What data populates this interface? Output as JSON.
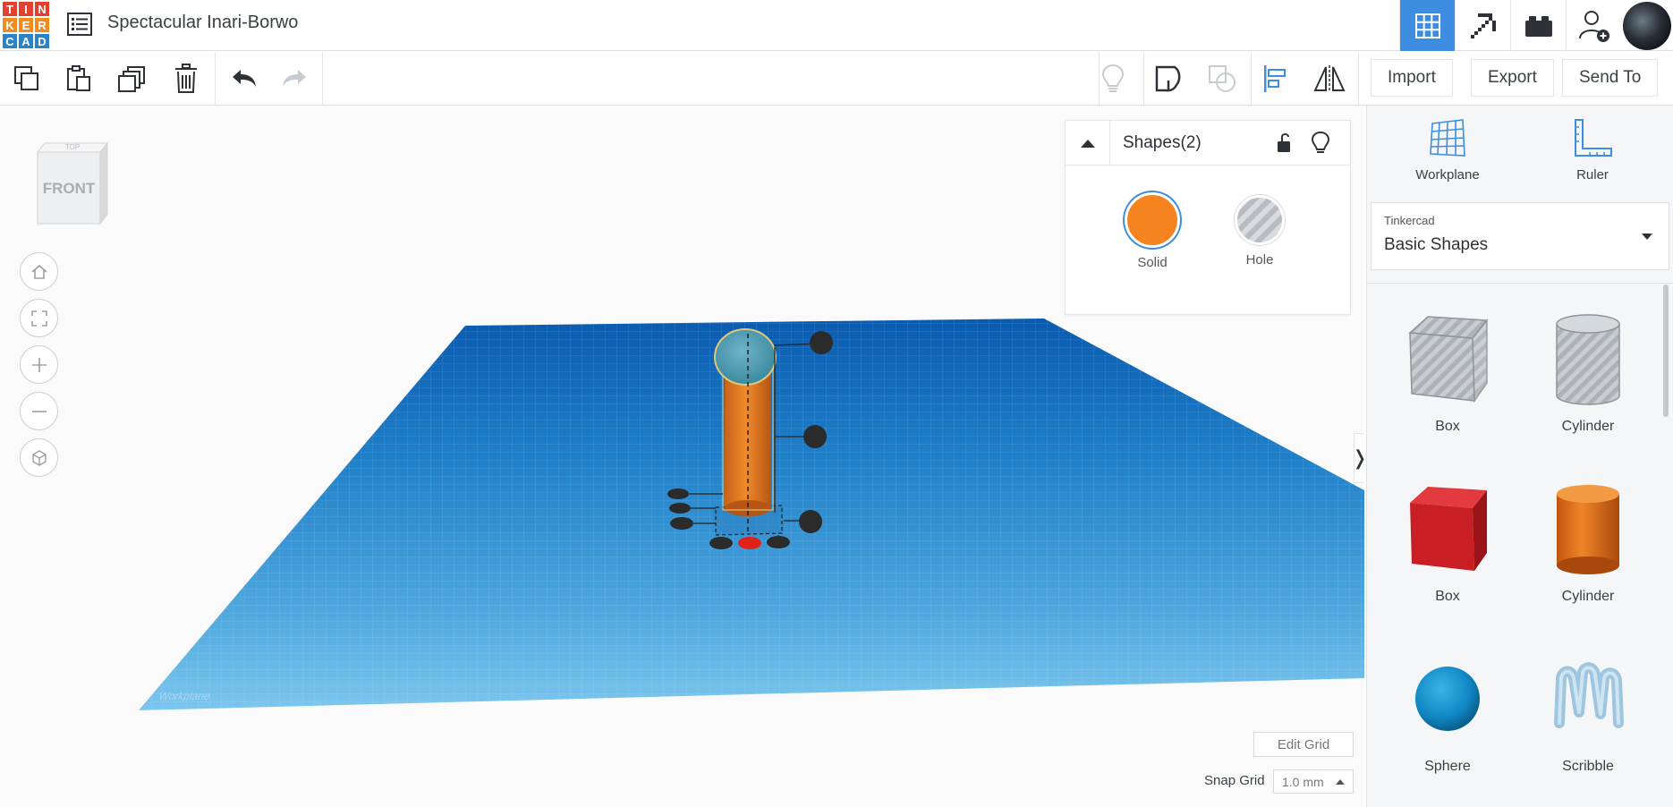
{
  "logo": {
    "letters": [
      "T",
      "I",
      "N",
      "K",
      "E",
      "R",
      "C",
      "A",
      "D"
    ],
    "colors": [
      "#e5402f",
      "#e5402f",
      "#e5402f",
      "#f28c1e",
      "#f28c1e",
      "#f28c1e",
      "#2a83c7",
      "#2a83c7",
      "#2a83c7"
    ]
  },
  "header": {
    "design_title": "Spectacular Inari-Borwo",
    "menu_icon": "list-icon",
    "right_icons": [
      "grid-3d-icon",
      "pickaxe-icon",
      "bricks-icon",
      "add-user-icon",
      "profile-avatar"
    ]
  },
  "toolbar": {
    "left_icons": [
      "copy-icon",
      "paste-icon",
      "duplicate-icon",
      "delete-icon",
      "undo-icon",
      "redo-icon"
    ],
    "right_icons": [
      "lightbulb-icon",
      "group-icon",
      "ungroup-icon",
      "align-icon",
      "mirror-icon"
    ],
    "import_label": "Import",
    "export_label": "Export",
    "send_to_label": "Send To"
  },
  "viewport": {
    "view_cube_face": "FRONT",
    "view_cube_top": "TOP",
    "nav_icons": [
      "home-view-icon",
      "fit-view-icon",
      "zoom-in-icon",
      "zoom-out-icon",
      "perspective-icon"
    ],
    "workplane_label": "Workplane",
    "edit_grid_label": "Edit Grid",
    "snap_grid_label": "Snap Grid",
    "snap_grid_value": "1.0 mm"
  },
  "shape_panel": {
    "title": "Shapes(2)",
    "solid_label": "Solid",
    "hole_label": "Hole",
    "solid_color": "#f5831f"
  },
  "sidebar": {
    "workplane_label": "Workplane",
    "ruler_label": "Ruler",
    "library_group": "Tinkercad",
    "library_name": "Basic Shapes",
    "shapes": [
      {
        "label": "Box",
        "kind": "hole-box"
      },
      {
        "label": "Cylinder",
        "kind": "hole-cylinder"
      },
      {
        "label": "Box",
        "kind": "box"
      },
      {
        "label": "Cylinder",
        "kind": "cylinder"
      },
      {
        "label": "Sphere",
        "kind": "sphere"
      },
      {
        "label": "Scribble",
        "kind": "scribble"
      }
    ]
  },
  "colors": {
    "accent": "#3d8ee0",
    "workplane_blue": "#1f7fc8",
    "red_handle": "#e0221b"
  }
}
